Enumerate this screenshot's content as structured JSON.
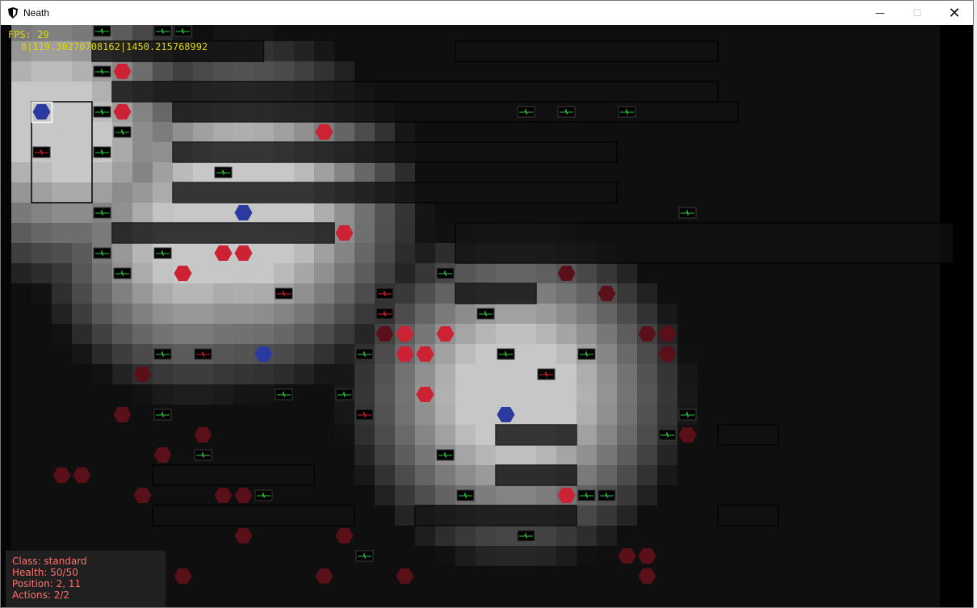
{
  "window": {
    "title": "Neath",
    "minimize_glyph": "—",
    "maximize_glyph": "☐",
    "close_glyph": "✕"
  },
  "hud": {
    "fps": "FPS: 29",
    "debug": "8|119.30270708162|1450.215768992"
  },
  "player_panel": {
    "class": "Class: standard",
    "health": "Health: 50/50",
    "position": "Position: 2, 11",
    "actions": "Actions: 2/2"
  },
  "colors": {
    "fps_text": "#e0d800",
    "panel_text": "#ff7070",
    "ally_hex": "#2a3aa0",
    "enemy_hex_bright": "#cc2233",
    "enemy_hex_dim": "#5a1018",
    "terminal_green": "#2ecc40",
    "terminal_red": "#e0202a"
  },
  "icons": {
    "app": "shield-icon",
    "ally": "blue-hexagon",
    "enemy": "red-hexagon",
    "device": "terminal-icon"
  }
}
